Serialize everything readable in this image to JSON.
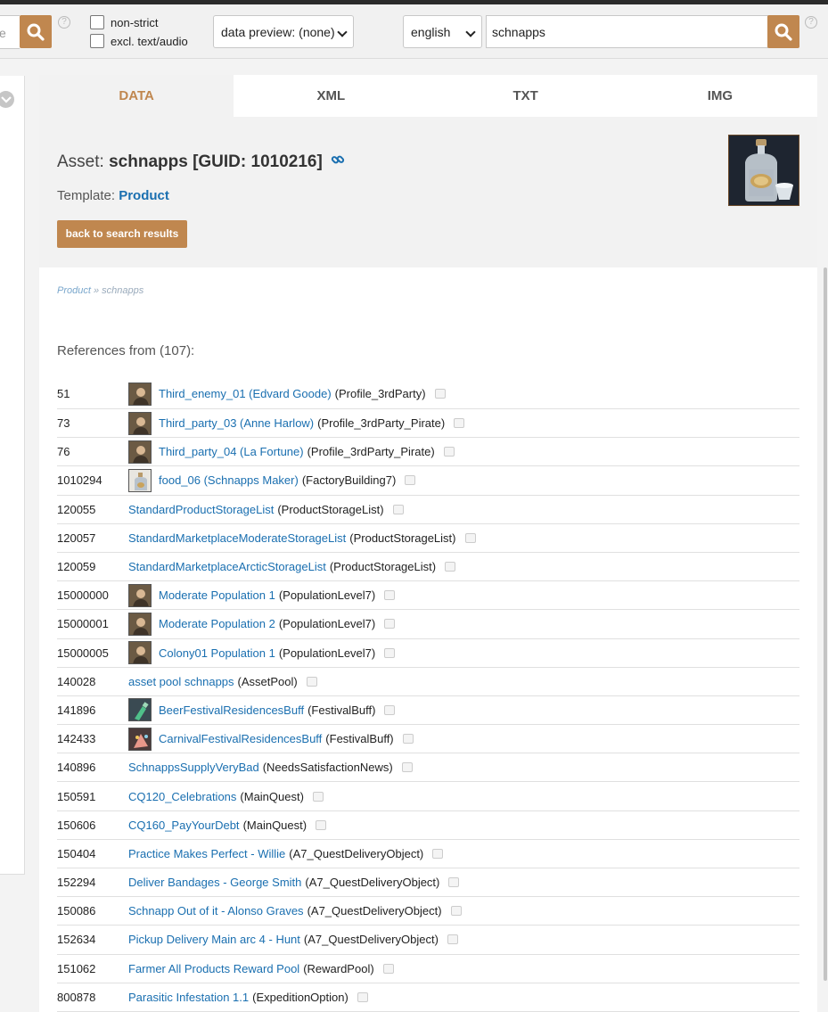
{
  "toolbar": {
    "left_search_fragment": "e",
    "help_glyph": "?",
    "checkbox_nonstrict": "non-strict",
    "checkbox_excl": "excl. text/audio",
    "data_preview": "data preview: (none)",
    "language": "english",
    "search_value": "schnapps"
  },
  "tabs": [
    {
      "label": "DATA",
      "active": true
    },
    {
      "label": "XML",
      "active": false
    },
    {
      "label": "TXT",
      "active": false
    },
    {
      "label": "IMG",
      "active": false
    }
  ],
  "asset": {
    "label": "Asset:",
    "name": "schnapps",
    "guid_text": "[GUID: 1010216]",
    "template_label": "Template:",
    "template_value": "Product",
    "back_button": "back to search results"
  },
  "breadcrumb": {
    "parent": "Product",
    "separator": "»",
    "current": "schnapps"
  },
  "references": {
    "heading": "References from (107):",
    "rows": [
      {
        "id": "51",
        "name": "Third_enemy_01 (Edvard Goode)",
        "type": "(Profile_3rdParty)",
        "thumb": "portrait-icon"
      },
      {
        "id": "73",
        "name": "Third_party_03 (Anne Harlow)",
        "type": "(Profile_3rdParty_Pirate)",
        "thumb": "portrait-icon"
      },
      {
        "id": "76",
        "name": "Third_party_04 (La Fortune)",
        "type": "(Profile_3rdParty_Pirate)",
        "thumb": "portrait-icon"
      },
      {
        "id": "1010294",
        "name": "food_06 (Schnapps Maker)",
        "type": "(FactoryBuilding7)",
        "thumb": "bottle-icon"
      },
      {
        "id": "120055",
        "name": "StandardProductStorageList",
        "type": "(ProductStorageList)",
        "thumb": ""
      },
      {
        "id": "120057",
        "name": "StandardMarketplaceModerateStorageList",
        "type": "(ProductStorageList)",
        "thumb": ""
      },
      {
        "id": "120059",
        "name": "StandardMarketplaceArcticStorageList",
        "type": "(ProductStorageList)",
        "thumb": ""
      },
      {
        "id": "15000000",
        "name": "Moderate Population 1",
        "type": "(PopulationLevel7)",
        "thumb": "portrait-icon"
      },
      {
        "id": "15000001",
        "name": "Moderate Population 2",
        "type": "(PopulationLevel7)",
        "thumb": "portrait-icon"
      },
      {
        "id": "15000005",
        "name": "Colony01 Population 1",
        "type": "(PopulationLevel7)",
        "thumb": "portrait-icon"
      },
      {
        "id": "140028",
        "name": "asset pool schnapps",
        "type": "(AssetPool)",
        "thumb": ""
      },
      {
        "id": "141896",
        "name": "BeerFestivalResidencesBuff",
        "type": "(FestivalBuff)",
        "thumb": "green-bottle-icon"
      },
      {
        "id": "142433",
        "name": "CarnivalFestivalResidencesBuff",
        "type": "(FestivalBuff)",
        "thumb": "confetti-icon"
      },
      {
        "id": "140896",
        "name": "SchnappsSupplyVeryBad",
        "type": "(NeedsSatisfactionNews)",
        "thumb": ""
      },
      {
        "id": "150591",
        "name": "CQ120_Celebrations",
        "type": "(MainQuest)",
        "thumb": ""
      },
      {
        "id": "150606",
        "name": "CQ160_PayYourDebt",
        "type": "(MainQuest)",
        "thumb": ""
      },
      {
        "id": "150404",
        "name": "Practice Makes Perfect - Willie",
        "type": "(A7_QuestDeliveryObject)",
        "thumb": ""
      },
      {
        "id": "152294",
        "name": "Deliver Bandages - George Smith",
        "type": "(A7_QuestDeliveryObject)",
        "thumb": ""
      },
      {
        "id": "150086",
        "name": "Schnapp Out of it - Alonso Graves",
        "type": "(A7_QuestDeliveryObject)",
        "thumb": ""
      },
      {
        "id": "152634",
        "name": "Pickup Delivery Main arc 4 - Hunt",
        "type": "(A7_QuestDeliveryObject)",
        "thumb": ""
      },
      {
        "id": "151062",
        "name": "Farmer All Products Reward Pool",
        "type": "(RewardPool)",
        "thumb": ""
      },
      {
        "id": "800878",
        "name": "Parasitic Infestation 1.1",
        "type": "(ExpeditionOption)",
        "thumb": ""
      }
    ]
  },
  "colors": {
    "accent": "#c0874f",
    "link": "#1a6fb0"
  }
}
